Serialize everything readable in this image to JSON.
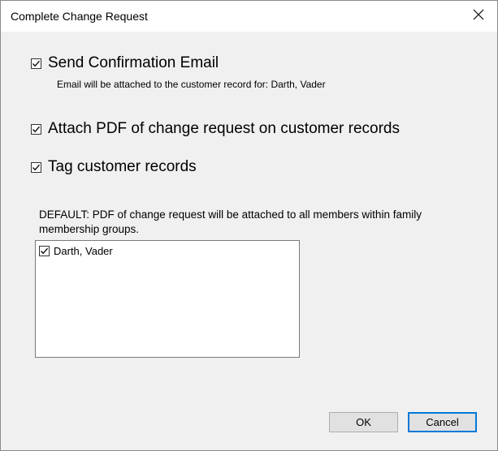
{
  "dialog": {
    "title": "Complete Change Request",
    "close_icon": "close-icon"
  },
  "options": {
    "send_email": {
      "label": "Send Confirmation Email",
      "checked": true
    },
    "email_hint": "Email will be attached to the customer record for: Darth, Vader",
    "attach_pdf": {
      "label": "Attach PDF of change request on customer records",
      "checked": true
    },
    "tag_records": {
      "label": "Tag customer records",
      "checked": true
    }
  },
  "default_note": "DEFAULT:  PDF of change request will be attached to all members within family membership groups.",
  "members_list": {
    "items": [
      {
        "label": "Darth, Vader",
        "checked": true
      }
    ]
  },
  "buttons": {
    "ok": "OK",
    "cancel": "Cancel"
  }
}
